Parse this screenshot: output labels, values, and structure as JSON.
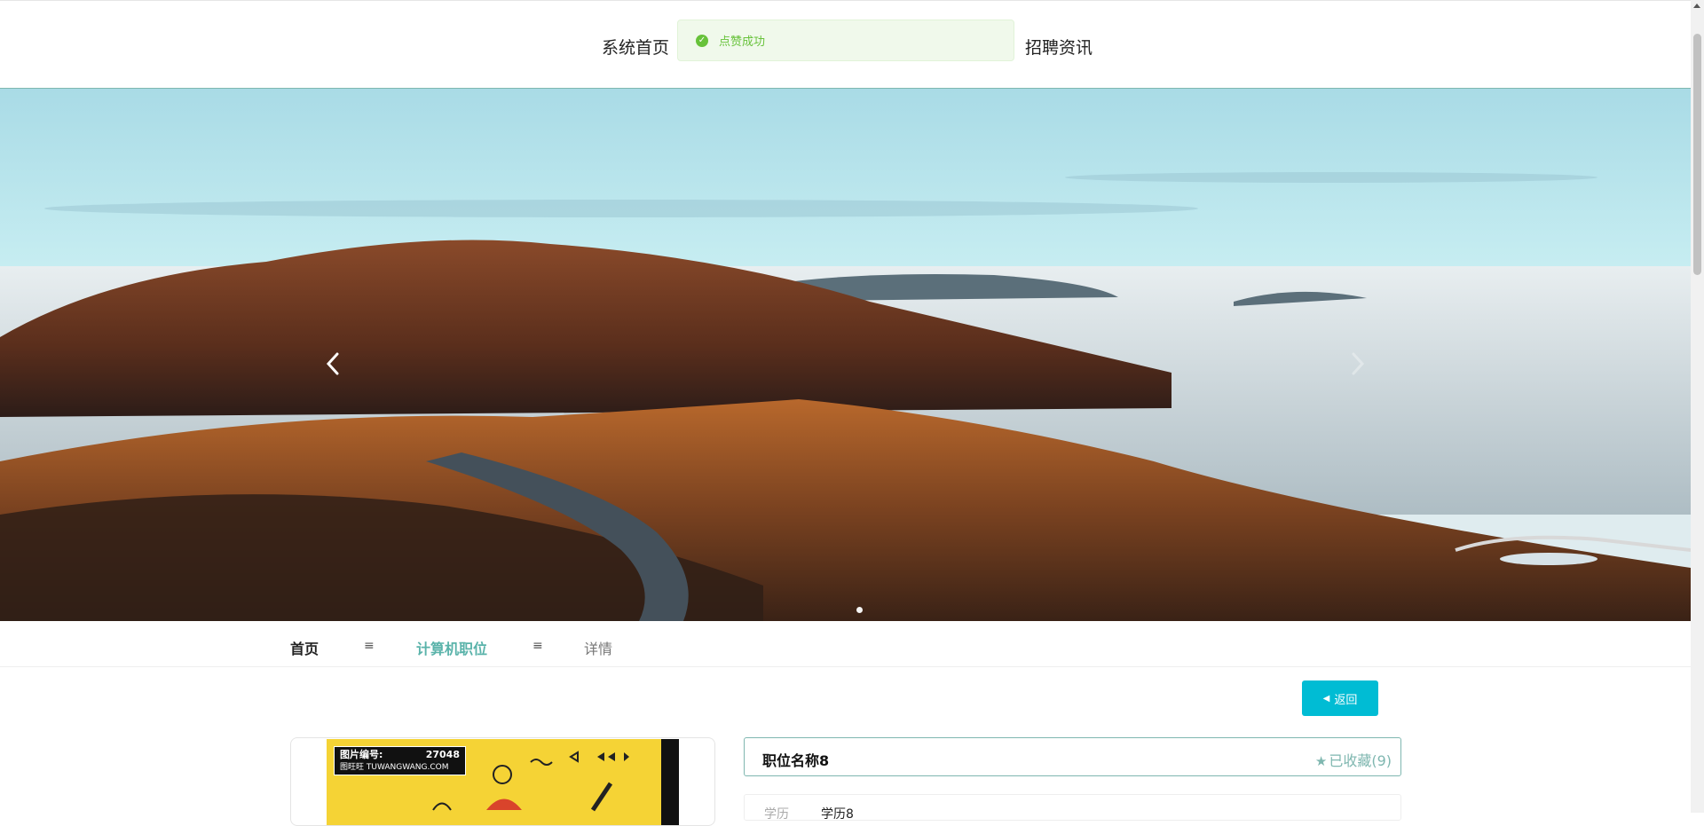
{
  "nav": {
    "home": "系统首页",
    "news": "招聘资讯"
  },
  "toast": {
    "message": "点赞成功",
    "status_color": "#67c23a"
  },
  "carousel": {
    "prev_icon": "chevron-left-icon",
    "next_icon": "chevron-right-icon",
    "slide_count": 1,
    "active_slide": 1
  },
  "breadcrumb": {
    "home": "首页",
    "separator": "≡",
    "category": "计算机职位",
    "current": "详情"
  },
  "back_button": {
    "label": "返回",
    "icon": "caret-left-icon",
    "color": "#00bcd4"
  },
  "poster": {
    "watermark_label": "图片编号:",
    "watermark_number": "27048",
    "watermark_site": "图旺旺 TUWANGWANG.COM"
  },
  "job": {
    "title": "职位名称8",
    "favorite_label": "已收藏(9)",
    "favorite_icon": "star-icon",
    "accent_color": "#7fb7b0"
  },
  "details": {
    "education_label": "学历",
    "education_value": "学历8"
  }
}
